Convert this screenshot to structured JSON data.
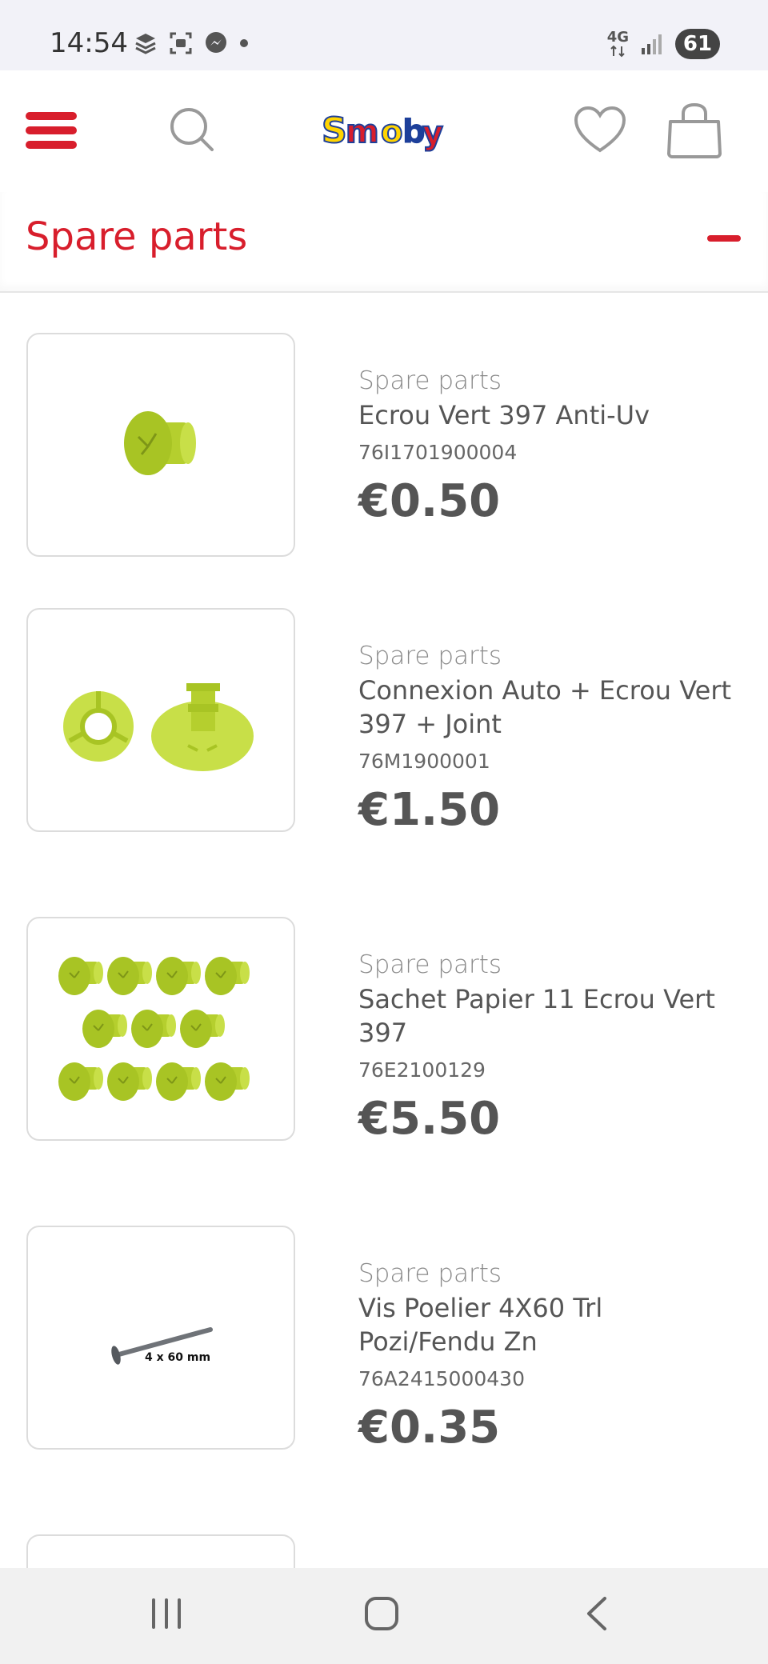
{
  "status_bar": {
    "time": "14:54",
    "network": "4G",
    "battery": "61"
  },
  "header": {
    "logo_text": "Smoby",
    "icons": [
      "menu-icon",
      "search-icon",
      "heart-icon",
      "shopping-bag-icon"
    ],
    "accent_color": "#d81e2c"
  },
  "section": {
    "title": "Spare parts"
  },
  "products": [
    {
      "category": "Spare parts",
      "name": "Ecrou Vert 397 Anti-Uv",
      "sku": "76I1701900004",
      "price": "€0.50"
    },
    {
      "category": "Spare parts",
      "name": "Connexion Auto + Ecrou Vert 397 + Joint",
      "sku": "76M1900001",
      "price": "€1.50"
    },
    {
      "category": "Spare parts",
      "name": "Sachet Papier 11 Ecrou Vert 397",
      "sku": "76E2100129",
      "price": "€5.50"
    },
    {
      "category": "Spare parts",
      "name": "Vis Poelier 4X60 Trl Pozi/Fendu Zn",
      "sku": "76A2415000430",
      "price": "€0.35",
      "image_label": "4 x 60 mm"
    }
  ],
  "nav": {
    "icons": [
      "recent-apps-icon",
      "home-icon",
      "back-icon"
    ]
  }
}
